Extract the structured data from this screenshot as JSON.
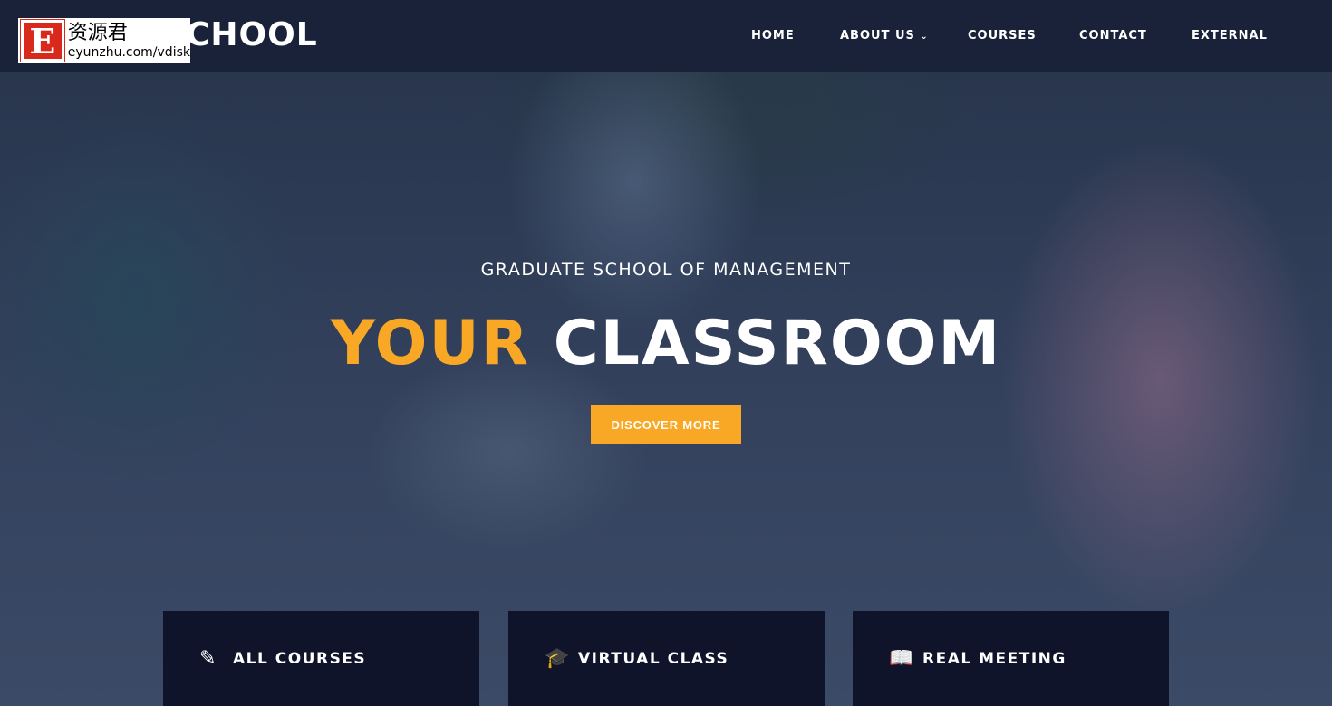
{
  "header": {
    "logo_text": "CHOOL",
    "watermark": {
      "letter": "E",
      "cn": "资源君",
      "url": "eyunzhu.com/vdisk"
    },
    "nav": [
      {
        "label": "HOME"
      },
      {
        "label": "ABOUT US",
        "dropdown": true
      },
      {
        "label": "COURSES"
      },
      {
        "label": "CONTACT"
      },
      {
        "label": "EXTERNAL"
      }
    ]
  },
  "hero": {
    "subtitle": "GRADUATE SCHOOL OF MANAGEMENT",
    "title_accent": "YOUR",
    "title_rest": "CLASSROOM",
    "button": "DISCOVER MORE",
    "accent_color": "#f9a825"
  },
  "cards": [
    {
      "icon": "pencil-icon",
      "label": "ALL COURSES"
    },
    {
      "icon": "graduation-cap-icon",
      "label": "VIRTUAL CLASS"
    },
    {
      "icon": "book-icon",
      "label": "REAL MEETING"
    }
  ]
}
